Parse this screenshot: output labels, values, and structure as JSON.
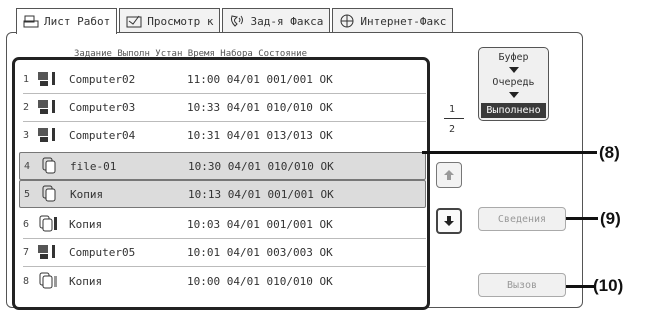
{
  "tabs": [
    {
      "label": "Лист Работ",
      "icon": "print-job-icon"
    },
    {
      "label": "Просмотр к",
      "icon": "scan-icon"
    },
    {
      "label": "Зад-я Факса",
      "icon": "phone-fax-icon"
    },
    {
      "label": "Интернет-Факс",
      "icon": "internet-fax-icon"
    }
  ],
  "column_header": "Задание Выполн  Устан Время Набора  Состояние",
  "rows": [
    {
      "num": "1",
      "name": "Computer02",
      "info": "11:00 04/01 001/001 OK",
      "icon": "computer-icon"
    },
    {
      "num": "2",
      "name": "Computer03",
      "info": "10:33 04/01 010/010 OK",
      "icon": "computer-icon"
    },
    {
      "num": "3",
      "name": "Computer04",
      "info": "10:31 04/01 013/013 OK",
      "icon": "computer-icon"
    },
    {
      "num": "4",
      "name": "file-01",
      "info": "10:30 04/01 010/010 OK",
      "icon": "copy-icon"
    },
    {
      "num": "5",
      "name": "Копия",
      "info": "10:13 04/01 001/001 OK",
      "icon": "copy-icon"
    },
    {
      "num": "6",
      "name": "Копия",
      "info": "10:03 04/01 001/001 OK",
      "icon": "copy-icon"
    },
    {
      "num": "7",
      "name": "Computer05",
      "info": "10:01 04/01 003/003 OK",
      "icon": "computer-icon"
    },
    {
      "num": "8",
      "name": "Копия",
      "info": "10:00 04/01 010/010 OK",
      "icon": "copy-icon"
    }
  ],
  "mode_switch": {
    "buffer": "Буфер",
    "queue": "Очередь",
    "done": "Выполнено"
  },
  "pagination": {
    "current": "1",
    "total": "2"
  },
  "buttons": {
    "details": "Сведения",
    "call": "Вызов"
  },
  "callouts": {
    "list": "(8)",
    "details": "(9)",
    "call": "(10)"
  }
}
